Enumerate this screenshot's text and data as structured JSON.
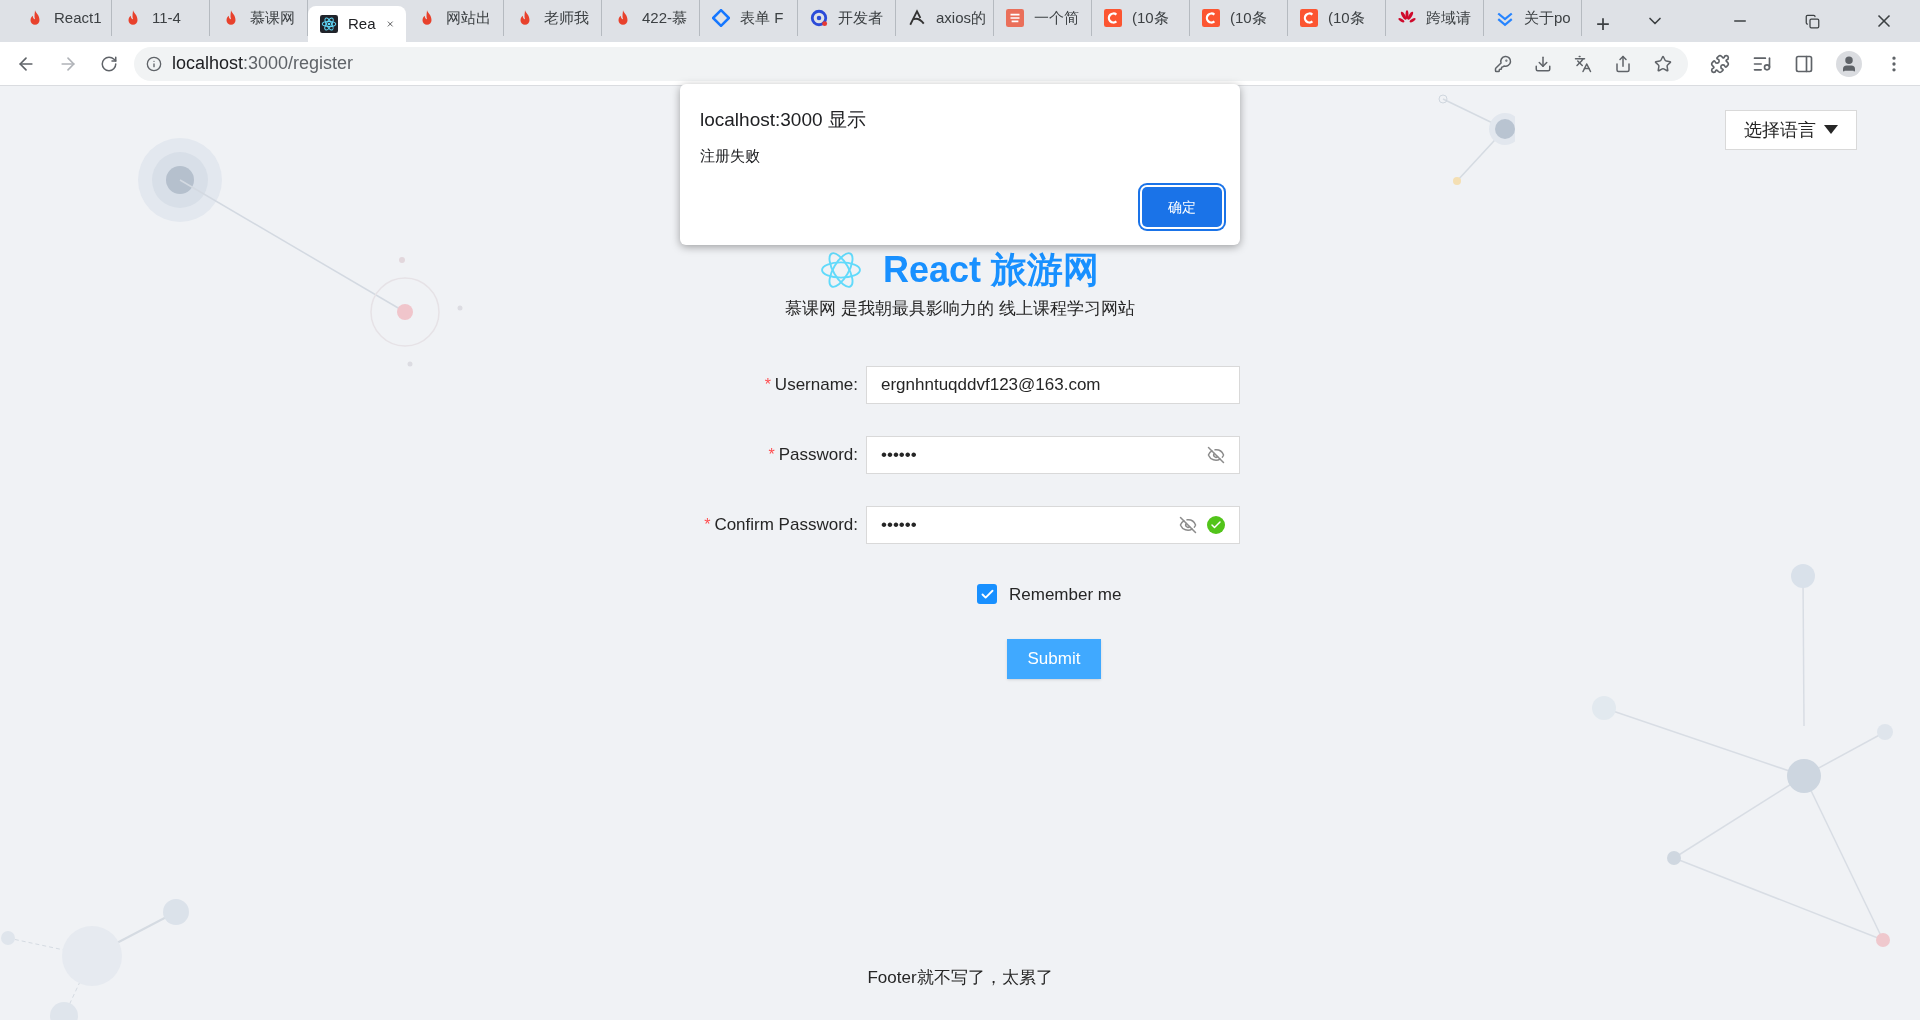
{
  "browser": {
    "tabs": [
      {
        "title": "React1",
        "kind": "flame",
        "selected": false
      },
      {
        "title": "11-4",
        "kind": "flame",
        "selected": false
      },
      {
        "title": "慕课网",
        "kind": "flame",
        "selected": false
      },
      {
        "title": "Rea",
        "kind": "atom",
        "selected": true
      },
      {
        "title": "网站出",
        "kind": "flame",
        "selected": false
      },
      {
        "title": "老师我",
        "kind": "flame",
        "selected": false
      },
      {
        "title": "422-慕",
        "kind": "flame",
        "selected": false
      },
      {
        "title": "表单 F",
        "kind": "diamond",
        "selected": false
      },
      {
        "title": "开发者",
        "kind": "ring",
        "selected": false
      },
      {
        "title": "axios的",
        "kind": "glyph",
        "selected": false
      },
      {
        "title": "一个简",
        "kind": "square",
        "selected": false
      },
      {
        "title": "(10条",
        "kind": "letter",
        "selected": false
      },
      {
        "title": "(10条",
        "kind": "letter",
        "selected": false
      },
      {
        "title": "(10条",
        "kind": "letter",
        "selected": false
      },
      {
        "title": "跨域请",
        "kind": "petals",
        "selected": false
      },
      {
        "title": "关于po",
        "kind": "chevrons",
        "selected": false
      }
    ],
    "new_tab": "+",
    "url_host": "localhost",
    "url_path": ":3000/register"
  },
  "language_select": {
    "label": "选择语言"
  },
  "header": {
    "title": "React 旅游网",
    "subtitle": "慕课网 是我朝最具影响力的 线上课程学习网站"
  },
  "form": {
    "fields": [
      {
        "required_mark": "*",
        "label": "Username:",
        "value": "ergnhntuqddvf123@163.com",
        "kind": "text"
      },
      {
        "required_mark": "*",
        "label": "Password:",
        "value": "••••••",
        "kind": "password",
        "validated": false
      },
      {
        "required_mark": "*",
        "label": "Confirm Password:",
        "value": "••••••",
        "kind": "password",
        "validated": true
      }
    ],
    "remember": {
      "label": "Remember me",
      "checked": true
    },
    "submit": "Submit"
  },
  "footer": "Footer就不写了，太累了",
  "alert": {
    "title": "localhost:3000 显示",
    "message": "注册失败",
    "button": "确定"
  }
}
